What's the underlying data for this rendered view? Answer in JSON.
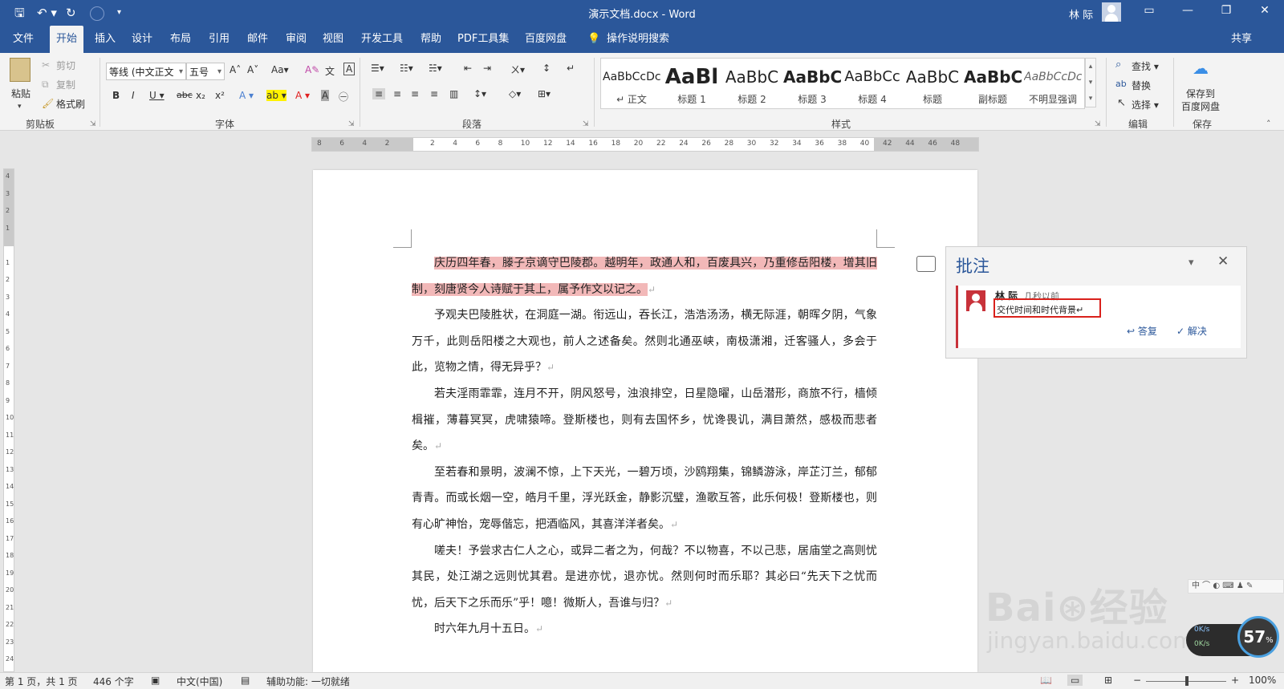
{
  "titlebar": {
    "title": "演示文档.docx  -  Word",
    "user": "林 际",
    "qa_save": "🖫",
    "qa_undo": "↶ ▾",
    "qa_redo": "↻",
    "qa_more": "▾",
    "ribbon_display": "▭",
    "minimize": "—",
    "restore": "❐",
    "close": "✕"
  },
  "menu": {
    "tabs": [
      "文件",
      "开始",
      "插入",
      "设计",
      "布局",
      "引用",
      "邮件",
      "审阅",
      "视图",
      "开发工具",
      "帮助",
      "PDF工具集",
      "百度网盘"
    ],
    "active_tab": "开始",
    "tell_me": "操作说明搜索",
    "share": "共享"
  },
  "ribbon": {
    "clipboard": {
      "paste": "粘贴",
      "cut": "剪切",
      "copy": "复制",
      "format_painter": "格式刷",
      "label": "剪贴板"
    },
    "font": {
      "font_name": "等线 (中文正文",
      "font_size": "五号",
      "label": "字体",
      "grow": "A˄",
      "shrink": "A˅",
      "case": "Aa▾",
      "clear": "A✎",
      "phonetic": "文",
      "border_char": "A",
      "bold": "B",
      "italic": "I",
      "underline": "U ▾",
      "strike": "abc",
      "sub": "x₂",
      "sup": "x²",
      "effects": "A ▾",
      "highlight": "ab ▾",
      "color": "A ▾",
      "shade": "A",
      "enclose": "㊀"
    },
    "paragraph": {
      "label": "段落",
      "bullets": "☰▾",
      "numbering": "☷▾",
      "multilevel": "☵▾",
      "dec_indent": "⇤",
      "inc_indent": "⇥",
      "cn_layout": "ㄨ▾",
      "sort": "↕",
      "marks": "↵",
      "left": "≡",
      "center": "≡",
      "right": "≡",
      "justify": "≡",
      "distributed": "▥",
      "spacing": "↕▾",
      "shading": "◇▾",
      "borders": "⊞▾"
    },
    "styles": {
      "label": "样式",
      "items": [
        {
          "sample": "AaBbCcDc",
          "name": "↵ 正文"
        },
        {
          "sample": "AaBl",
          "name": "标题 1"
        },
        {
          "sample": "AaBbC",
          "name": "标题 2"
        },
        {
          "sample": "AaBbC",
          "name": "标题 3"
        },
        {
          "sample": "AaBbCc",
          "name": "标题 4"
        },
        {
          "sample": "AaBbC",
          "name": "标题"
        },
        {
          "sample": "AaBbC",
          "name": "副标题"
        },
        {
          "sample": "AaBbCcDc",
          "name": "不明显强调"
        }
      ],
      "scroll_up": "▴",
      "scroll_down": "▾",
      "more": "▾"
    },
    "editing": {
      "label": "编辑",
      "find": "查找 ▾",
      "replace": "替换",
      "select": "选择 ▾"
    },
    "save": {
      "label": "保存",
      "save_to": "保存到",
      "baidu": "百度网盘"
    }
  },
  "ruler": {
    "h_ticks": [
      "8",
      "6",
      "4",
      "2",
      "",
      "2",
      "4",
      "6",
      "8",
      "10",
      "12",
      "14",
      "16",
      "18",
      "20",
      "22",
      "24",
      "26",
      "28",
      "30",
      "32",
      "34",
      "36",
      "38",
      "40",
      "42",
      "44",
      "46",
      "48"
    ],
    "v_ticks": [
      "4",
      "3",
      "2",
      "1",
      "",
      "1",
      "2",
      "3",
      "4",
      "5",
      "6",
      "7",
      "8",
      "9",
      "10",
      "11",
      "12",
      "13",
      "14",
      "15",
      "16",
      "17",
      "18",
      "19",
      "20",
      "21",
      "22",
      "23",
      "24"
    ]
  },
  "document": {
    "paragraphs": [
      "庆历四年春，滕子京谪守巴陵郡。越明年，政通人和，百废具兴，乃重修岳阳楼，增其旧制，刻唐贤今人诗赋于其上，属予作文以记之。",
      "予观夫巴陵胜状，在洞庭一湖。衔远山，吞长江，浩浩汤汤，横无际涯，朝晖夕阴，气象万千，此则岳阳楼之大观也，前人之述备矣。然则北通巫峡，南极潇湘，迁客骚人，多会于此，览物之情，得无异乎？",
      "若夫淫雨霏霏，连月不开，阴风怒号，浊浪排空，日星隐曜，山岳潜形，商旅不行，樯倾楫摧，薄暮冥冥，虎啸猿啼。登斯楼也，则有去国怀乡，忧谗畏讥，满目萧然，感极而悲者矣。",
      "至若春和景明，波澜不惊，上下天光，一碧万顷，沙鸥翔集，锦鳞游泳，岸芷汀兰，郁郁青青。而或长烟一空，皓月千里，浮光跃金，静影沉璧，渔歌互答，此乐何极！登斯楼也，则有心旷神怡，宠辱偕忘，把酒临风，其喜洋洋者矣。",
      "嗟夫！予尝求古仁人之心，或异二者之为，何哉？不以物喜，不以己悲，居庙堂之高则忧其民，处江湖之远则忧其君。是进亦忧，退亦忧。然则何时而乐耶？其必曰“先天下之忧而忧，后天下之乐而乐”乎！噫！微斯人，吾谁与归？",
      "时六年九月十五日。"
    ],
    "para_mark": "↵"
  },
  "comments": {
    "title": "批注",
    "chevron": "▾",
    "close": "✕",
    "items": [
      {
        "author": "林 际",
        "time": "几秒以前",
        "text": "交代时间和时代背景↵",
        "reply": "答复",
        "resolve": "解决"
      }
    ]
  },
  "status": {
    "page": "第 1 页，共 1 页",
    "words": "446 个字",
    "lang": "中文(中国)",
    "accessibility": "辅助功能: 一切就绪",
    "zoom_minus": "−",
    "zoom_plus": "+",
    "zoom": "100%"
  },
  "overlays": {
    "watermark_main": "Bai⊛经验",
    "watermark_sub": "jingyan.baidu.com",
    "ime": "中 ⌒ ◐ ⌨ ♟ ✎",
    "speed_up": "0K/s",
    "speed_down": "0K/s",
    "speed_percent": "57",
    "speed_unit": "%"
  }
}
